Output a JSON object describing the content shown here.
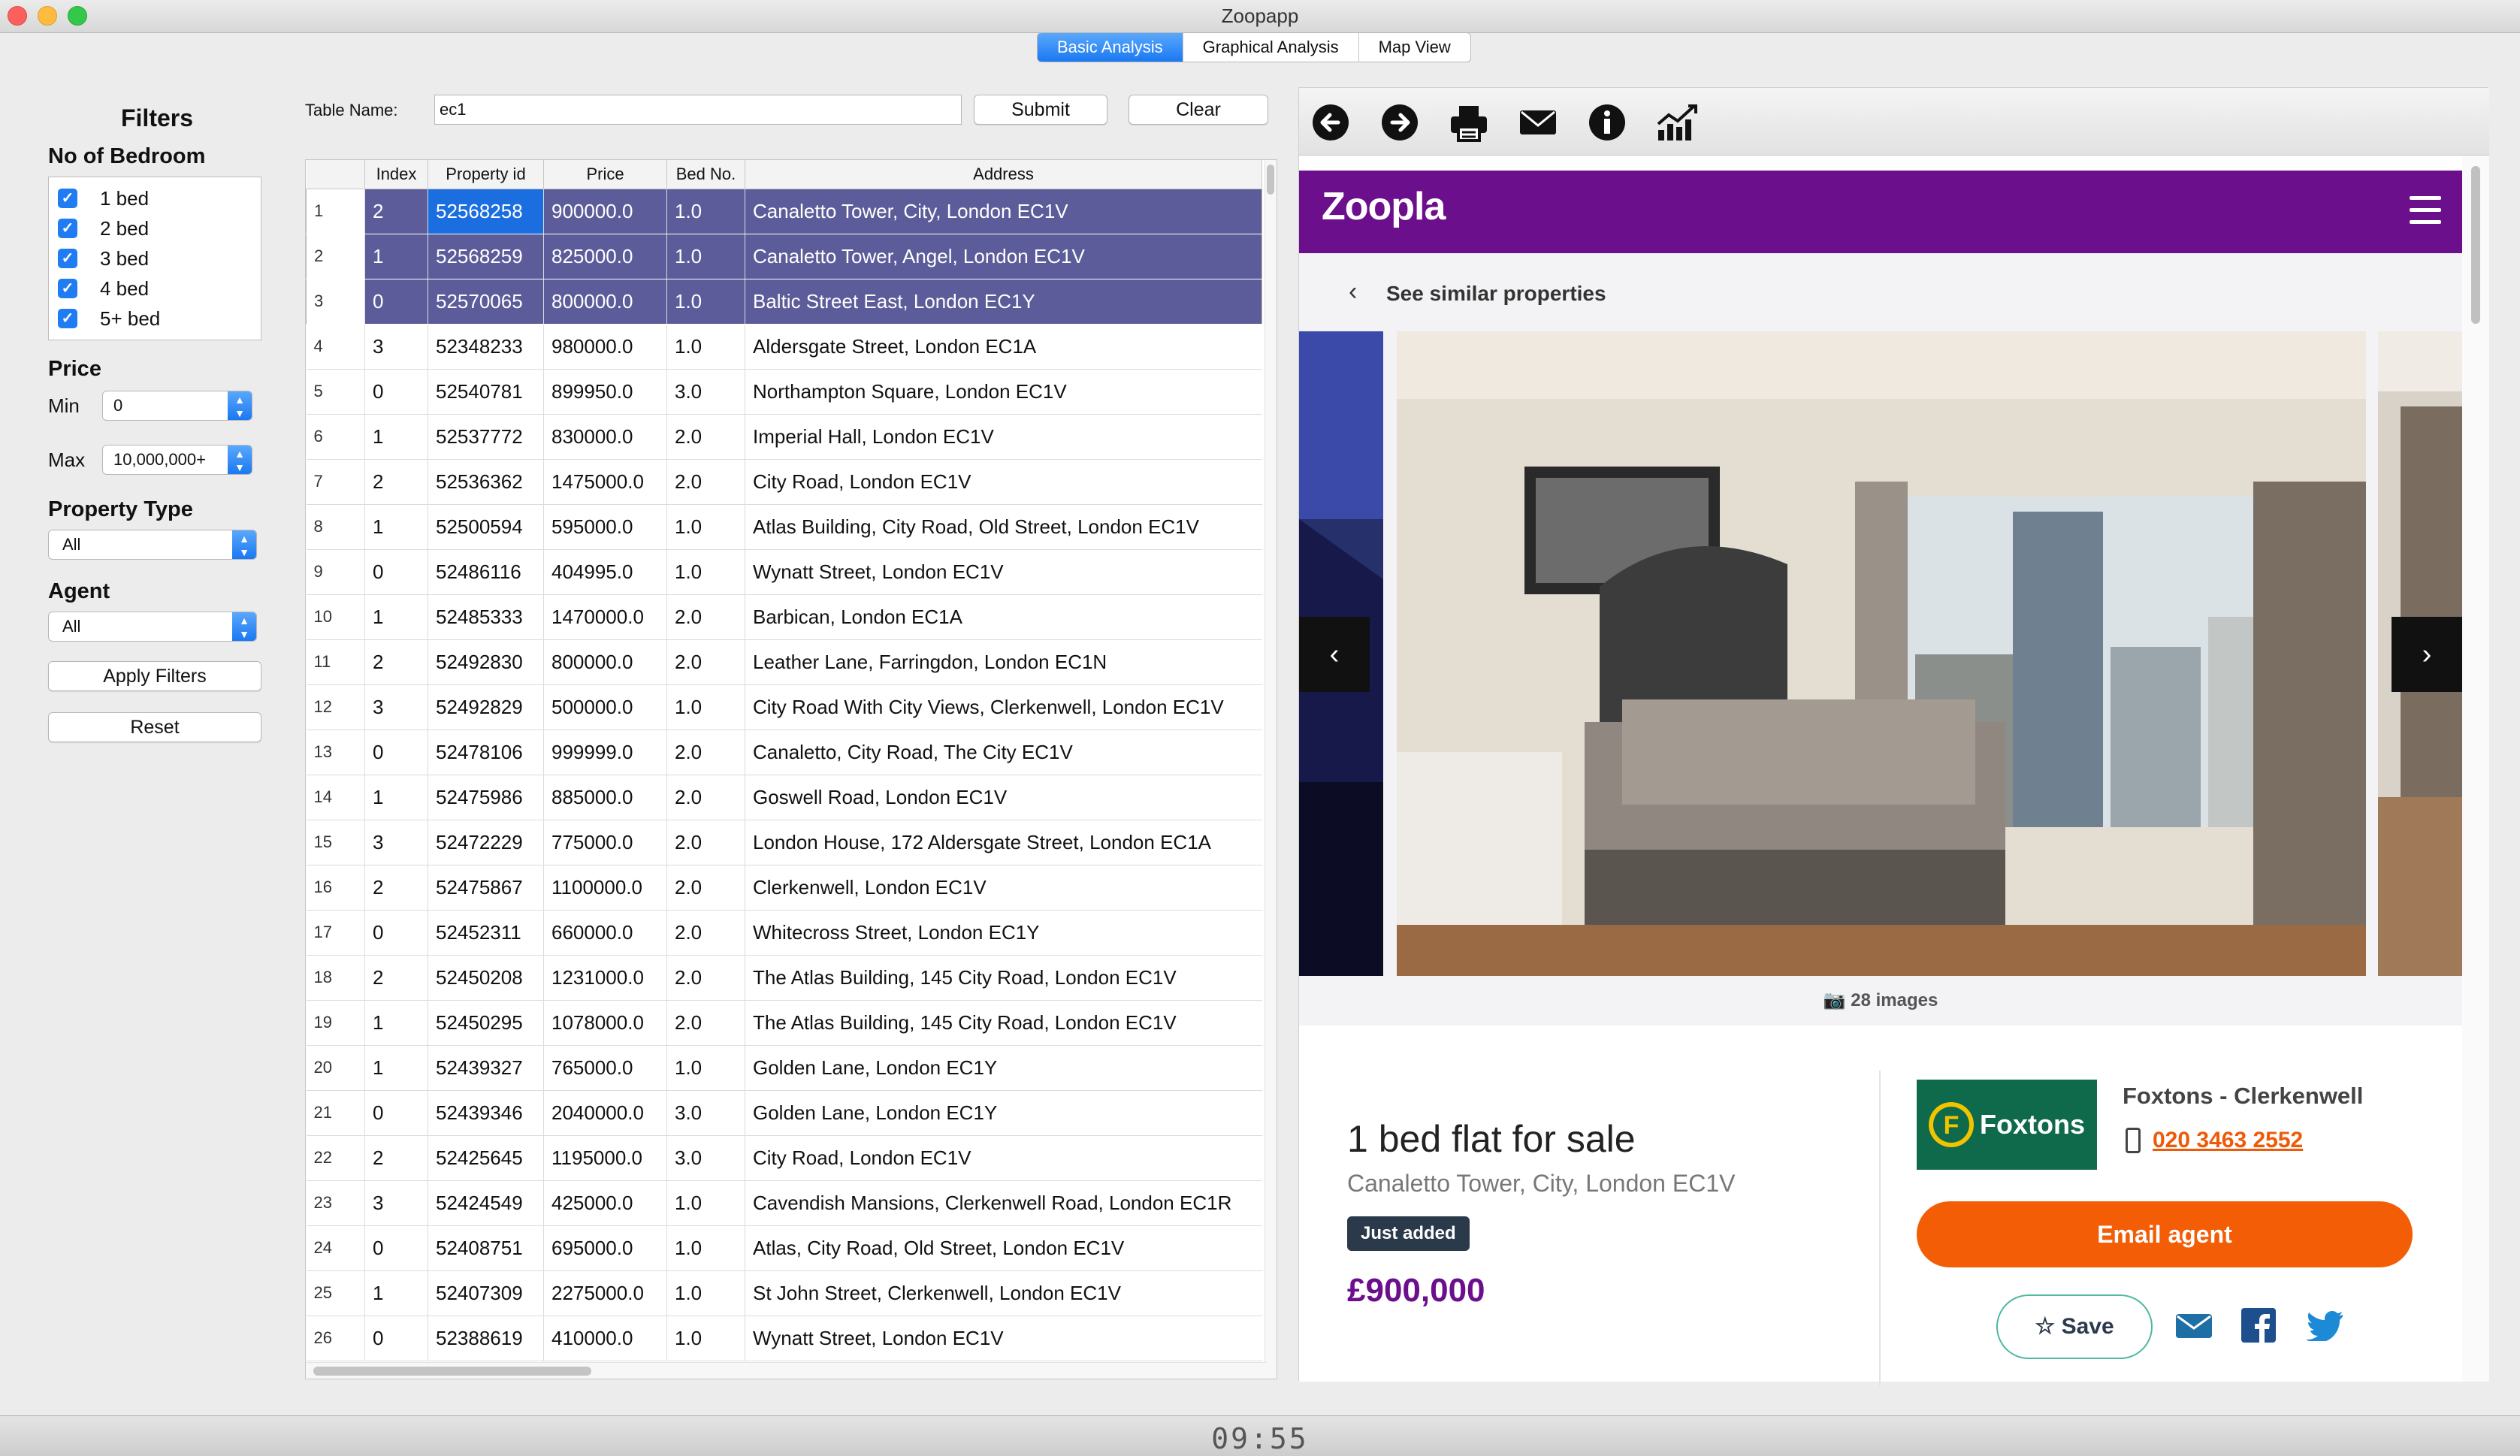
{
  "window": {
    "title": "Zoopapp"
  },
  "tabs": [
    {
      "label": "Basic Analysis",
      "active": true
    },
    {
      "label": "Graphical Analysis",
      "active": false
    },
    {
      "label": "Map View",
      "active": false
    }
  ],
  "filters": {
    "title": "Filters",
    "bedroom_title": "No of Bedroom",
    "bedrooms": [
      {
        "label": "1 bed",
        "checked": true
      },
      {
        "label": "2 bed",
        "checked": true
      },
      {
        "label": "3 bed",
        "checked": true
      },
      {
        "label": "4 bed",
        "checked": true
      },
      {
        "label": "5+ bed",
        "checked": true
      }
    ],
    "price_title": "Price",
    "min_label": "Min",
    "min_value": "0",
    "max_label": "Max",
    "max_value": "10,000,000+",
    "property_type_title": "Property Type",
    "property_type_value": "All",
    "agent_title": "Agent",
    "agent_value": "All",
    "apply_label": "Apply Filters",
    "reset_label": "Reset"
  },
  "query": {
    "table_name_label": "Table Name:",
    "table_name_value": "ec1",
    "submit_label": "Submit",
    "clear_label": "Clear"
  },
  "table": {
    "columns": [
      "Index",
      "Property id",
      "Price",
      "Bed No.",
      "Address"
    ],
    "rows": [
      {
        "n": "1",
        "index": "2",
        "pid": "52568258",
        "price": "900000.0",
        "bed": "1.0",
        "address": "Canaletto Tower, City, London EC1V",
        "selected": true
      },
      {
        "n": "2",
        "index": "1",
        "pid": "52568259",
        "price": "825000.0",
        "bed": "1.0",
        "address": "Canaletto Tower, Angel, London EC1V",
        "selected": true
      },
      {
        "n": "3",
        "index": "0",
        "pid": "52570065",
        "price": "800000.0",
        "bed": "1.0",
        "address": "Baltic Street East, London EC1Y",
        "selected": true
      },
      {
        "n": "4",
        "index": "3",
        "pid": "52348233",
        "price": "980000.0",
        "bed": "1.0",
        "address": "Aldersgate Street, London EC1A"
      },
      {
        "n": "5",
        "index": "0",
        "pid": "52540781",
        "price": "899950.0",
        "bed": "3.0",
        "address": "Northampton Square, London EC1V"
      },
      {
        "n": "6",
        "index": "1",
        "pid": "52537772",
        "price": "830000.0",
        "bed": "2.0",
        "address": "Imperial Hall, London EC1V"
      },
      {
        "n": "7",
        "index": "2",
        "pid": "52536362",
        "price": "1475000.0",
        "bed": "2.0",
        "address": "City Road, London EC1V"
      },
      {
        "n": "8",
        "index": "1",
        "pid": "52500594",
        "price": "595000.0",
        "bed": "1.0",
        "address": "Atlas Building, City Road, Old Street, London EC1V"
      },
      {
        "n": "9",
        "index": "0",
        "pid": "52486116",
        "price": "404995.0",
        "bed": "1.0",
        "address": "Wynatt Street, London EC1V"
      },
      {
        "n": "10",
        "index": "1",
        "pid": "52485333",
        "price": "1470000.0",
        "bed": "2.0",
        "address": "Barbican, London EC1A"
      },
      {
        "n": "11",
        "index": "2",
        "pid": "52492830",
        "price": "800000.0",
        "bed": "2.0",
        "address": "Leather Lane, Farringdon, London EC1N"
      },
      {
        "n": "12",
        "index": "3",
        "pid": "52492829",
        "price": "500000.0",
        "bed": "1.0",
        "address": "City Road With City Views, Clerkenwell, London EC1V"
      },
      {
        "n": "13",
        "index": "0",
        "pid": "52478106",
        "price": "999999.0",
        "bed": "2.0",
        "address": "Canaletto, City Road, The City EC1V"
      },
      {
        "n": "14",
        "index": "1",
        "pid": "52475986",
        "price": "885000.0",
        "bed": "2.0",
        "address": "Goswell Road, London EC1V"
      },
      {
        "n": "15",
        "index": "3",
        "pid": "52472229",
        "price": "775000.0",
        "bed": "2.0",
        "address": "London House, 172 Aldersgate Street, London EC1A"
      },
      {
        "n": "16",
        "index": "2",
        "pid": "52475867",
        "price": "1100000.0",
        "bed": "2.0",
        "address": "Clerkenwell, London EC1V"
      },
      {
        "n": "17",
        "index": "0",
        "pid": "52452311",
        "price": "660000.0",
        "bed": "2.0",
        "address": "Whitecross Street, London EC1Y"
      },
      {
        "n": "18",
        "index": "2",
        "pid": "52450208",
        "price": "1231000.0",
        "bed": "2.0",
        "address": "The Atlas Building, 145 City Road, London EC1V"
      },
      {
        "n": "19",
        "index": "1",
        "pid": "52450295",
        "price": "1078000.0",
        "bed": "2.0",
        "address": "The Atlas Building, 145 City Road, London EC1V"
      },
      {
        "n": "20",
        "index": "1",
        "pid": "52439327",
        "price": "765000.0",
        "bed": "1.0",
        "address": "Golden Lane, London EC1Y"
      },
      {
        "n": "21",
        "index": "0",
        "pid": "52439346",
        "price": "2040000.0",
        "bed": "3.0",
        "address": "Golden Lane, London EC1Y"
      },
      {
        "n": "22",
        "index": "2",
        "pid": "52425645",
        "price": "1195000.0",
        "bed": "3.0",
        "address": "City Road, London EC1V"
      },
      {
        "n": "23",
        "index": "3",
        "pid": "52424549",
        "price": "425000.0",
        "bed": "1.0",
        "address": "Cavendish Mansions, Clerkenwell Road, London EC1R"
      },
      {
        "n": "24",
        "index": "0",
        "pid": "52408751",
        "price": "695000.0",
        "bed": "1.0",
        "address": "Atlas, City Road, Old Street, London EC1V"
      },
      {
        "n": "25",
        "index": "1",
        "pid": "52407309",
        "price": "2275000.0",
        "bed": "1.0",
        "address": "St John Street, Clerkenwell, London EC1V"
      },
      {
        "n": "26",
        "index": "0",
        "pid": "52388619",
        "price": "410000.0",
        "bed": "1.0",
        "address": "Wynatt Street, London EC1V"
      }
    ]
  },
  "toolbar": {
    "icons": [
      "back-arrow-icon",
      "forward-arrow-icon",
      "printer-icon",
      "envelope-icon",
      "info-icon",
      "chart-trend-icon"
    ]
  },
  "listing": {
    "brand": "Zoopla",
    "brand_color": "#6c0f8c",
    "similar_label": "See similar properties",
    "image_count": "28 images",
    "title": "1 bed flat for sale",
    "address": "Canaletto Tower, City, London EC1V",
    "badge": "Just added",
    "price": "£900,000",
    "agent_logo_text": "Foxtons",
    "agent_name": "Foxtons - Clerkenwell",
    "agent_phone": "020 3463 2552",
    "email_button": "Email agent",
    "save_button": "Save",
    "accent_color": "#f35d05"
  },
  "status": {
    "clock": "09:55"
  }
}
